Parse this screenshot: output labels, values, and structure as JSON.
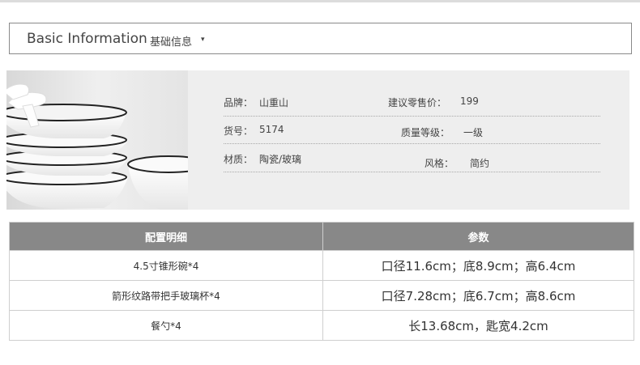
{
  "header": {
    "title_en": "Basic Information",
    "title_zh": "基础信息",
    "caret": "▾"
  },
  "product_info": {
    "brand": {
      "label": "品牌：",
      "value": "山重山"
    },
    "price": {
      "label": "建议零售价：",
      "value": "199"
    },
    "item_no": {
      "label": "货号：",
      "value": "5174"
    },
    "grade": {
      "label": "质量等级：",
      "value": "一级"
    },
    "material": {
      "label": "材质：",
      "value": "陶瓷/玻璃"
    },
    "style": {
      "label": "风格：",
      "value": "简约"
    }
  },
  "spec_table": {
    "headers": [
      "配置明细",
      "参数"
    ],
    "rows": [
      [
        "4.5寸锥形碗*4",
        "口径11.6cm；底8.9cm；高6.4cm"
      ],
      [
        "箭形纹路带把手玻璃杯*4",
        "口径7.28cm；底6.7cm；高8.6cm"
      ],
      [
        "餐勺*4",
        "长13.68cm，匙宽4.2cm"
      ]
    ]
  },
  "colors": {
    "table_header": "#888888",
    "panel": "#eeeeee",
    "bowl_rim": "#222222"
  }
}
